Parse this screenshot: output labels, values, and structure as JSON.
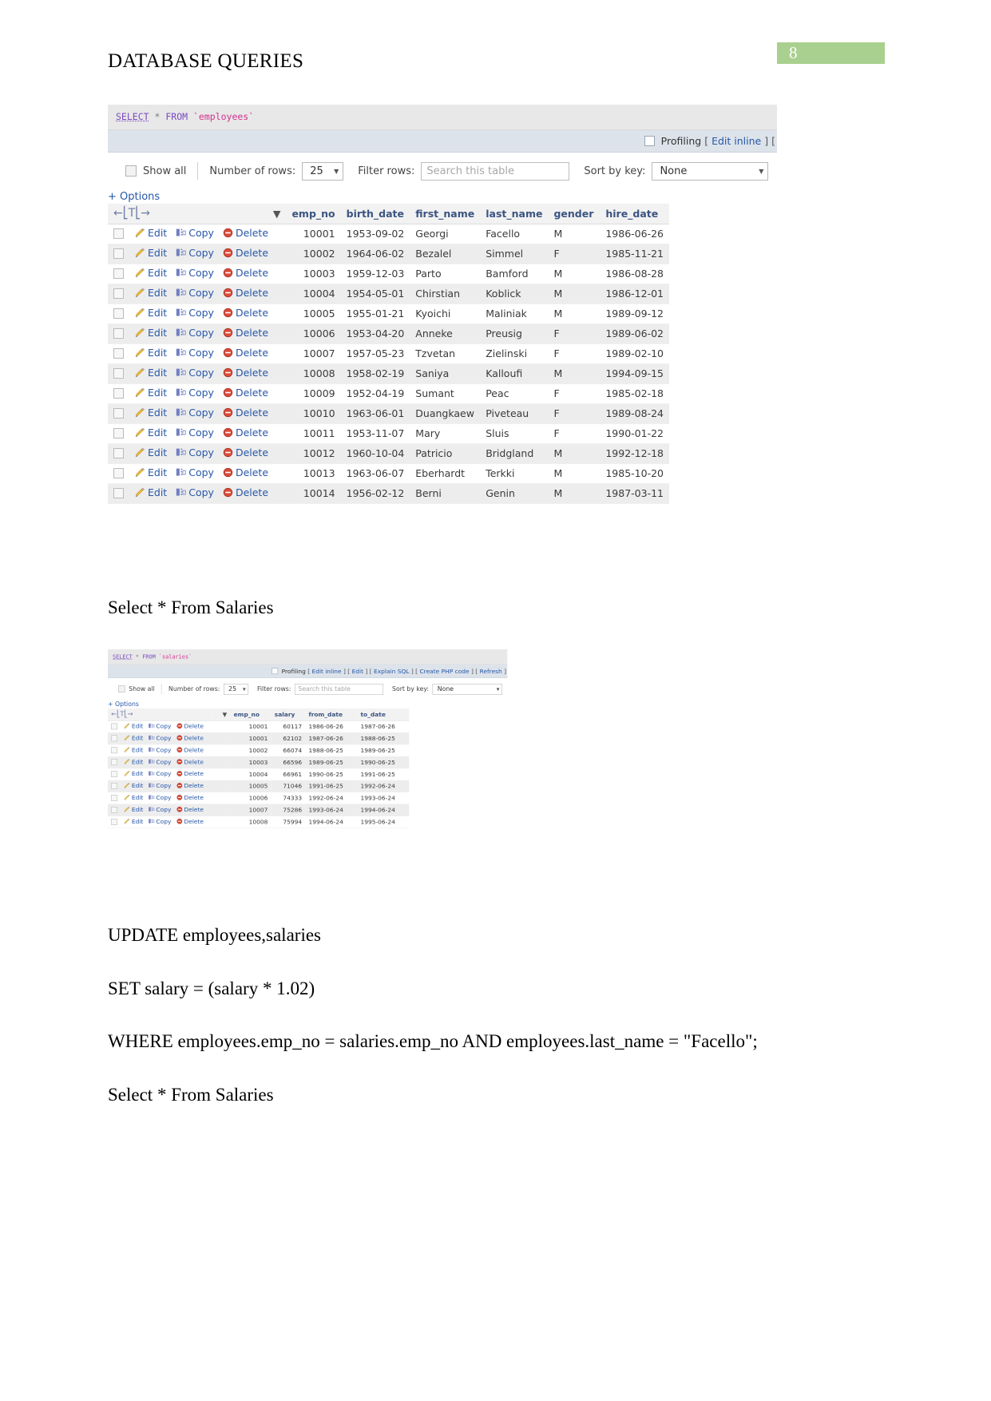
{
  "page": {
    "number": "8",
    "badge_color": "#a9d08e",
    "title": "DATABASE QUERIES"
  },
  "text_blocks": {
    "line1": "Select * From Salaries",
    "line2": "UPDATE employees,salaries",
    "line3": "SET salary = (salary * 1.02)",
    "line4": "WHERE employees.emp_no = salaries.emp_no AND employees.last_name = \"Facello\";",
    "line5": "Select * From Salaries"
  },
  "screenshot_1": {
    "sql": {
      "keyword": "SELECT",
      "star": "*",
      "from": "FROM",
      "table": "`employees`"
    },
    "actionbar": {
      "profiling_label": "Profiling",
      "links": [
        "Edit inline"
      ],
      "trailing": "["
    },
    "controls": {
      "show_all_label": "Show all",
      "rows_label": "Number of rows:",
      "rows_value": "25",
      "filter_label": "Filter rows:",
      "filter_placeholder": "Search this table",
      "sort_label": "Sort by key:",
      "sort_value": "None"
    },
    "options_label": "+ Options",
    "nav_glyph": "←［Ｔ］→",
    "columns": [
      "emp_no",
      "birth_date",
      "first_name",
      "last_name",
      "gender",
      "hire_date"
    ],
    "row_actions": {
      "edit": "Edit",
      "copy": "Copy",
      "delete": "Delete"
    },
    "rows": [
      [
        "10001",
        "1953-09-02",
        "Georgi",
        "Facello",
        "M",
        "1986-06-26"
      ],
      [
        "10002",
        "1964-06-02",
        "Bezalel",
        "Simmel",
        "F",
        "1985-11-21"
      ],
      [
        "10003",
        "1959-12-03",
        "Parto",
        "Bamford",
        "M",
        "1986-08-28"
      ],
      [
        "10004",
        "1954-05-01",
        "Chirstian",
        "Koblick",
        "M",
        "1986-12-01"
      ],
      [
        "10005",
        "1955-01-21",
        "Kyoichi",
        "Maliniak",
        "M",
        "1989-09-12"
      ],
      [
        "10006",
        "1953-04-20",
        "Anneke",
        "Preusig",
        "F",
        "1989-06-02"
      ],
      [
        "10007",
        "1957-05-23",
        "Tzvetan",
        "Zielinski",
        "F",
        "1989-02-10"
      ],
      [
        "10008",
        "1958-02-19",
        "Saniya",
        "Kalloufi",
        "M",
        "1994-09-15"
      ],
      [
        "10009",
        "1952-04-19",
        "Sumant",
        "Peac",
        "F",
        "1985-02-18"
      ],
      [
        "10010",
        "1963-06-01",
        "Duangkaew",
        "Piveteau",
        "F",
        "1989-08-24"
      ],
      [
        "10011",
        "1953-11-07",
        "Mary",
        "Sluis",
        "F",
        "1990-01-22"
      ],
      [
        "10012",
        "1960-10-04",
        "Patricio",
        "Bridgland",
        "M",
        "1992-12-18"
      ],
      [
        "10013",
        "1963-06-07",
        "Eberhardt",
        "Terkki",
        "M",
        "1985-10-20"
      ],
      [
        "10014",
        "1956-02-12",
        "Berni",
        "Genin",
        "M",
        "1987-03-11"
      ]
    ]
  },
  "screenshot_2": {
    "sql": {
      "keyword": "SELECT",
      "star": "*",
      "from": "FROM",
      "table": "`salaries`"
    },
    "actionbar": {
      "profiling_label": "Profiling",
      "links": [
        "Edit inline",
        "Edit",
        "Explain SQL",
        "Create PHP code",
        "Refresh"
      ]
    },
    "controls": {
      "show_all_label": "Show all",
      "rows_label": "Number of rows:",
      "rows_value": "25",
      "filter_label": "Filter rows:",
      "filter_placeholder": "Search this table",
      "sort_label": "Sort by key:",
      "sort_value": "None"
    },
    "options_label": "+ Options",
    "nav_glyph": "←［Ｔ］→",
    "columns": [
      "emp_no",
      "salary",
      "from_date",
      "to_date"
    ],
    "row_actions": {
      "edit": "Edit",
      "copy": "Copy",
      "delete": "Delete"
    },
    "rows": [
      [
        "10001",
        "60117",
        "1986-06-26",
        "1987-06-26"
      ],
      [
        "10001",
        "62102",
        "1987-06-26",
        "1988-06-25"
      ],
      [
        "10002",
        "66074",
        "1988-06-25",
        "1989-06-25"
      ],
      [
        "10003",
        "66596",
        "1989-06-25",
        "1990-06-25"
      ],
      [
        "10004",
        "66961",
        "1990-06-25",
        "1991-06-25"
      ],
      [
        "10005",
        "71046",
        "1991-06-25",
        "1992-06-24"
      ],
      [
        "10006",
        "74333",
        "1992-06-24",
        "1993-06-24"
      ],
      [
        "10007",
        "75286",
        "1993-06-24",
        "1994-06-24"
      ],
      [
        "10008",
        "75994",
        "1994-06-24",
        "1995-06-24"
      ]
    ]
  }
}
